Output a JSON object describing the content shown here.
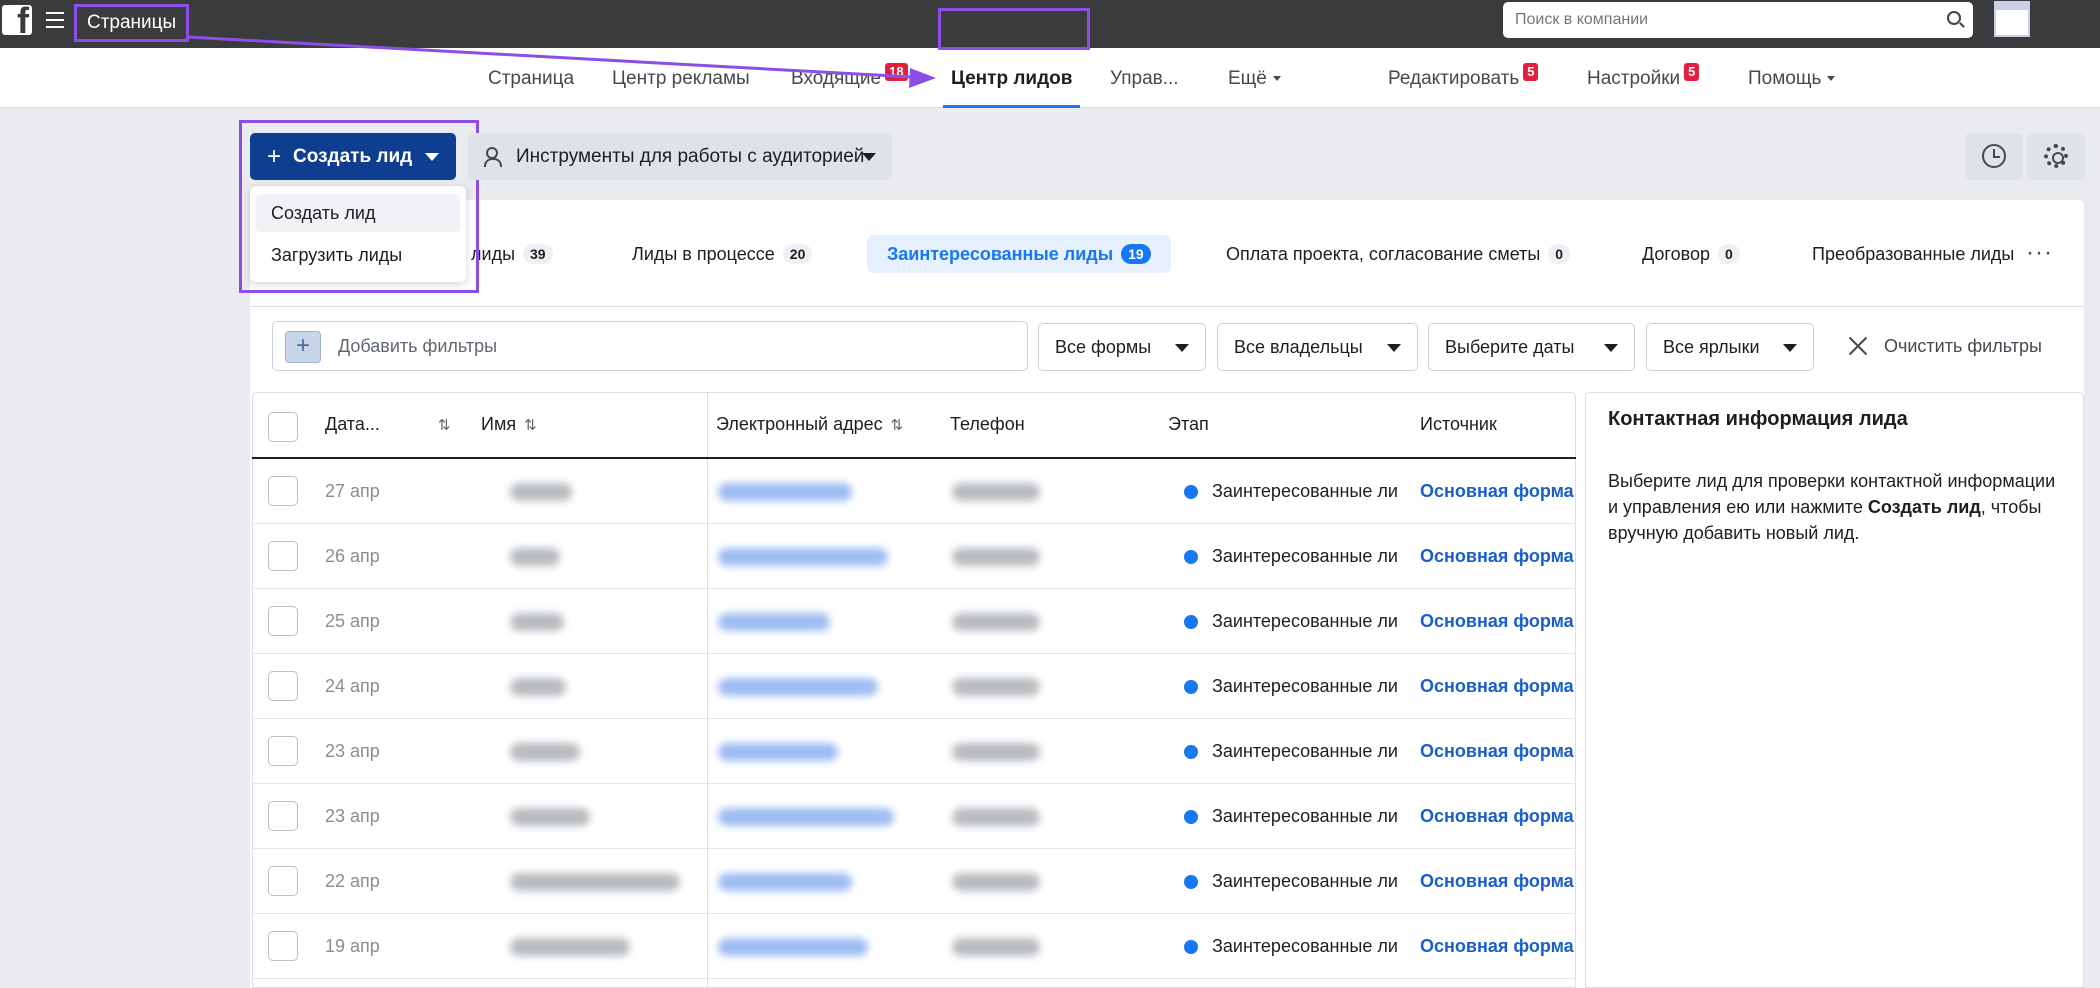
{
  "topbar": {
    "pages_label": "Страницы",
    "search_placeholder": "Поиск в компании"
  },
  "nav": {
    "items": [
      {
        "label": "Страница"
      },
      {
        "label": "Центр рекламы"
      },
      {
        "label": "Входящие",
        "badge": "18"
      },
      {
        "label": "Центр лидов",
        "active": true
      },
      {
        "label": "Управ..."
      },
      {
        "label": "Ещё"
      },
      {
        "label": "Редактировать",
        "badge": "5"
      },
      {
        "label": "Настройки",
        "badge": "5"
      },
      {
        "label": "Помощь"
      }
    ]
  },
  "toolbar": {
    "create_lead": "Создать лид",
    "create_lead_plus": "+",
    "audience_tools": "Инструменты для работы с аудиторией"
  },
  "dropdown": {
    "items": [
      "Создать лид",
      "Загрузить лиды"
    ]
  },
  "stages": [
    {
      "label": "е лиды",
      "count": "39"
    },
    {
      "label": "Лиды в процессе",
      "count": "20"
    },
    {
      "label": "Заинтересованные лиды",
      "count": "19",
      "active": true
    },
    {
      "label": "Оплата проекта, согласование сметы",
      "count": "0"
    },
    {
      "label": "Договор",
      "count": "0"
    },
    {
      "label": "Преобразованные лиды",
      "count": ""
    }
  ],
  "filters": {
    "add_filters": "Добавить фильтры",
    "all_forms": "Все формы",
    "all_owners": "Все владельцы",
    "choose_dates": "Выберите даты",
    "all_labels": "Все ярлыки",
    "clear": "Очистить фильтры"
  },
  "table": {
    "columns": [
      "Дата...",
      "Имя",
      "Электронный адрес",
      "Телефон",
      "Этап",
      "Источник"
    ],
    "rows": [
      {
        "date": "27 апр",
        "stage": "Заинтересованные ли",
        "source": "Основная форма"
      },
      {
        "date": "26 апр",
        "stage": "Заинтересованные ли",
        "source": "Основная форма"
      },
      {
        "date": "25 апр",
        "stage": "Заинтересованные ли",
        "source": "Основная форма"
      },
      {
        "date": "24 апр",
        "stage": "Заинтересованные ли",
        "source": "Основная форма"
      },
      {
        "date": "23 апр",
        "stage": "Заинтересованные ли",
        "source": "Основная форма"
      },
      {
        "date": "23 апр",
        "stage": "Заинтересованные ли",
        "source": "Основная форма"
      },
      {
        "date": "22 апр",
        "stage": "Заинтересованные ли",
        "source": "Основная форма"
      },
      {
        "date": "19 апр",
        "stage": "Заинтересованные ли",
        "source": "Основная форма"
      }
    ]
  },
  "side_panel": {
    "title": "Контактная информация лида",
    "text_before": "Выберите лид для проверки контактной информации и управления ею или нажмите ",
    "text_bold": "Создать лид",
    "text_after": ", чтобы вручную добавить новый лид."
  },
  "colors": {
    "accent": "#1877f2",
    "annotation": "#8c4fe6",
    "primary_button": "#0f3d8f",
    "badge": "#e41e3f"
  }
}
